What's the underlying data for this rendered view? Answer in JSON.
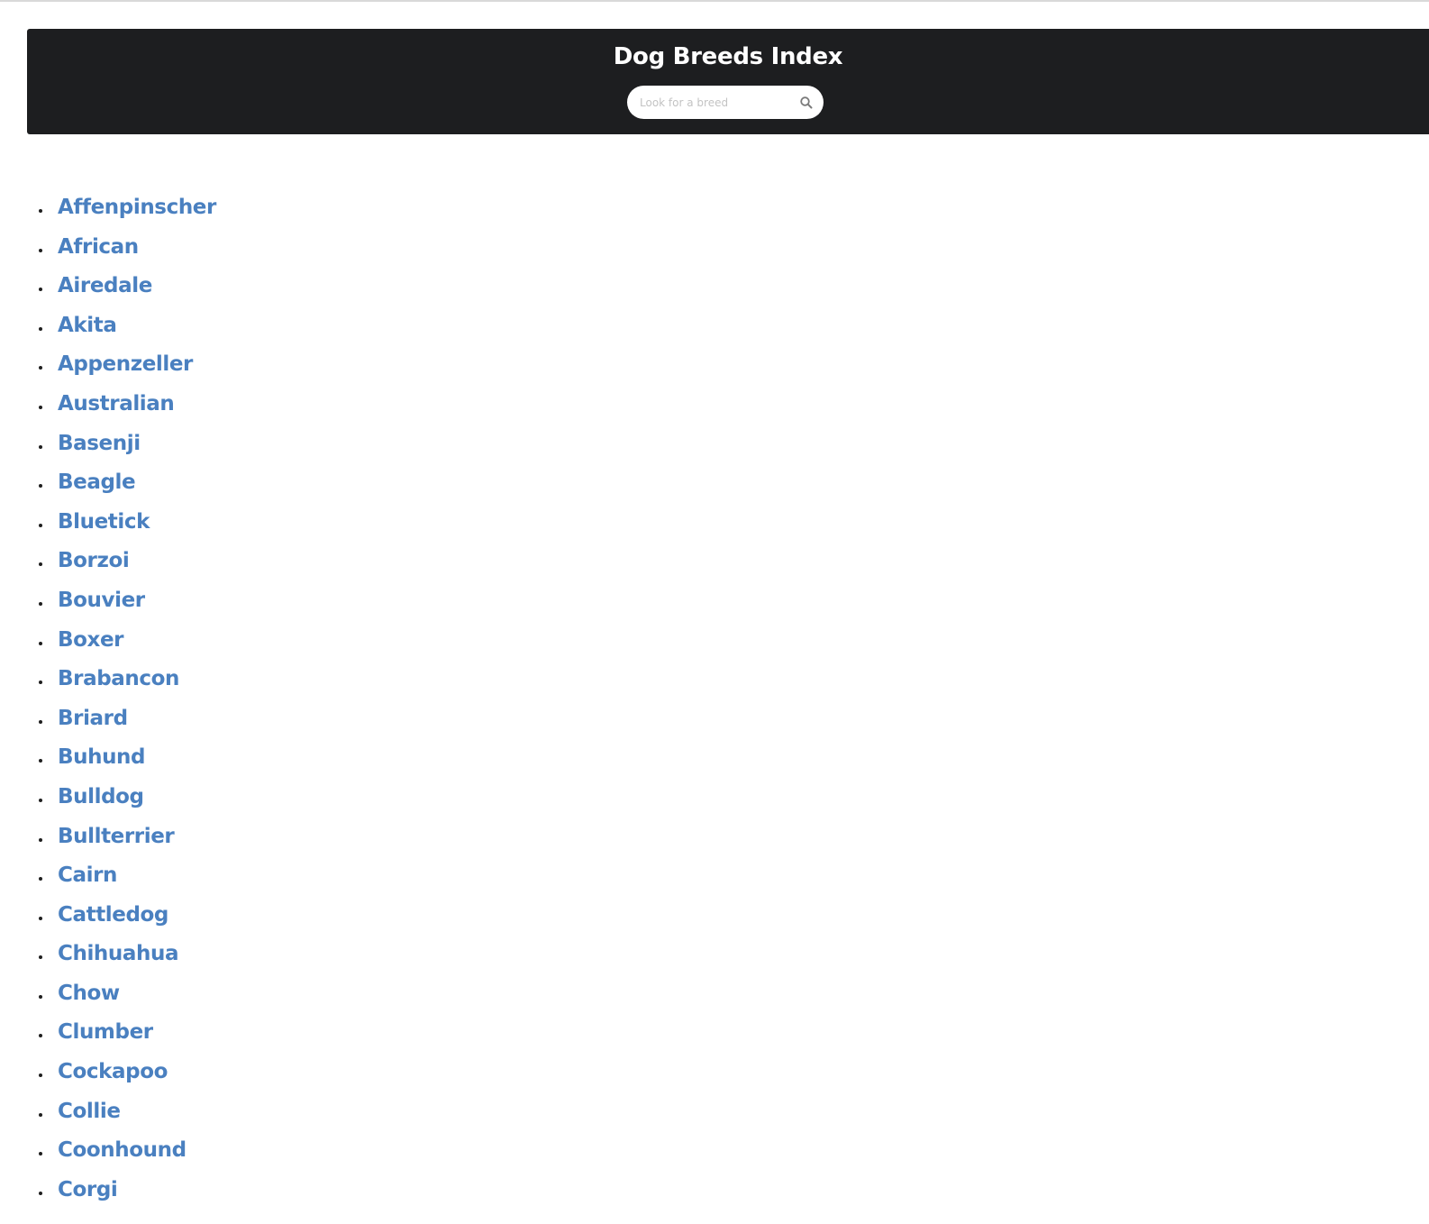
{
  "header": {
    "title": "Dog Breeds Index",
    "search": {
      "placeholder": "Look for a breed",
      "value": "",
      "icon": "search-icon"
    }
  },
  "breeds": [
    "Affenpinscher",
    "African",
    "Airedale",
    "Akita",
    "Appenzeller",
    "Australian",
    "Basenji",
    "Beagle",
    "Bluetick",
    "Borzoi",
    "Bouvier",
    "Boxer",
    "Brabancon",
    "Briard",
    "Buhund",
    "Bulldog",
    "Bullterrier",
    "Cairn",
    "Cattledog",
    "Chihuahua",
    "Chow",
    "Clumber",
    "Cockapoo",
    "Collie",
    "Coonhound",
    "Corgi"
  ],
  "colors": {
    "header_bg": "#1d1e20",
    "link": "#4a80c0"
  }
}
